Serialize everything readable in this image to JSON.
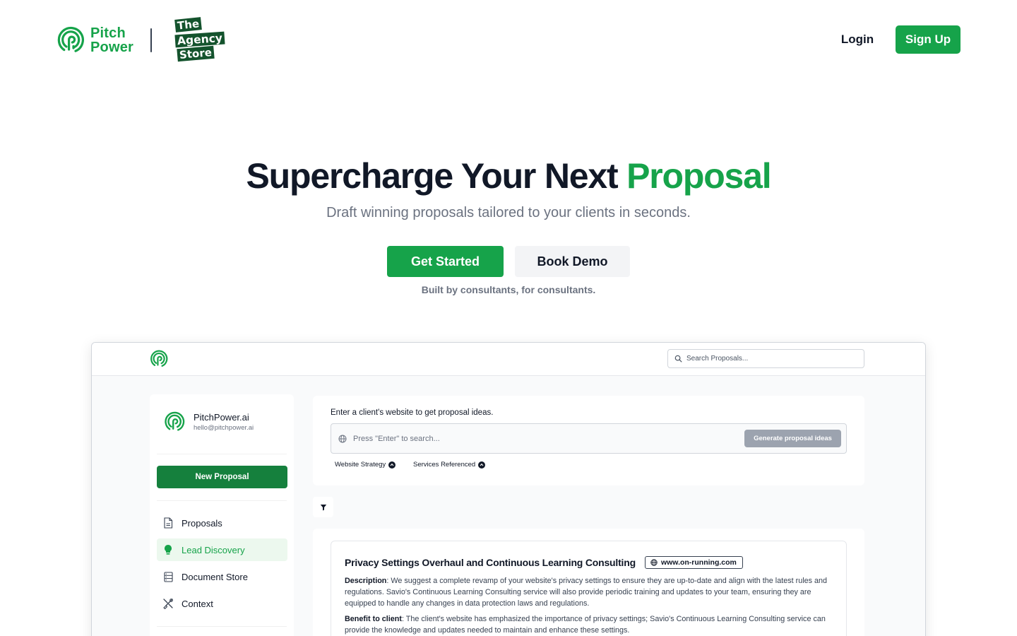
{
  "brand": {
    "name_line1": "Pitch",
    "name_line2": "Power",
    "partner_line1": "The",
    "partner_line2": "Agency",
    "partner_line3": "Store",
    "color": "#16a34a"
  },
  "nav": {
    "login": "Login",
    "signup": "Sign Up"
  },
  "hero": {
    "title_main": "Supercharge Your Next ",
    "title_accent": "Proposal",
    "subtitle": "Draft winning proposals tailored to your clients in seconds.",
    "cta_primary": "Get Started",
    "cta_secondary": "Book Demo",
    "tagline": "Built by consultants, for consultants."
  },
  "app": {
    "search_placeholder": "Search Proposals...",
    "profile": {
      "name": "PitchPower.ai",
      "email": "hello@pitchpower.ai"
    },
    "new_proposal": "New Proposal",
    "menu": [
      {
        "label": "Proposals",
        "icon": "document-icon",
        "active": false
      },
      {
        "label": "Lead Discovery",
        "icon": "lightbulb-icon",
        "active": true
      },
      {
        "label": "Document Store",
        "icon": "database-icon",
        "active": false
      },
      {
        "label": "Context",
        "icon": "tools-icon",
        "active": false
      }
    ],
    "input_panel": {
      "label": "Enter a client's website to get proposal ideas.",
      "placeholder": "Press \"Enter\" to search...",
      "generate": "Generate proposal ideas",
      "chips": [
        "Website Strategy",
        "Services Referenced"
      ]
    },
    "card": {
      "title": "Privacy Settings Overhaul and Continuous Learning Consulting",
      "site": "www.on-running.com",
      "description_label": "Description",
      "description": ": We suggest a complete revamp of your website's privacy settings to ensure they are up-to-date and align with the latest rules and regulations. Savio's Continuous Learning Consulting service will also provide periodic training and updates to your team, ensuring they are equipped to handle any changes in data protection laws and regulations.",
      "benefit_label": "Benefit to client",
      "benefit": ": The client's website has emphasized the importance of privacy settings; Savio's Continuous Learning Consulting service can provide the knowledge and updates needed to maintain and enhance these settings."
    }
  }
}
